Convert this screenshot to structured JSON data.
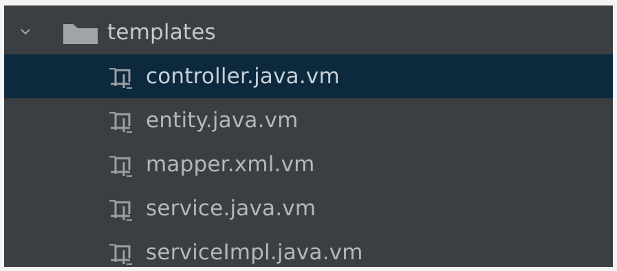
{
  "tree": {
    "folder": {
      "label": "templates",
      "icon": "folder-icon",
      "expanded": true
    },
    "files": [
      {
        "label": "controller.java.vm",
        "icon": "velocity-template-icon",
        "selected": true
      },
      {
        "label": "entity.java.vm",
        "icon": "velocity-template-icon",
        "selected": false
      },
      {
        "label": "mapper.xml.vm",
        "icon": "velocity-template-icon",
        "selected": false
      },
      {
        "label": "service.java.vm",
        "icon": "velocity-template-icon",
        "selected": false
      },
      {
        "label": "serviceImpl.java.vm",
        "icon": "velocity-template-icon",
        "selected": false
      }
    ]
  },
  "colors": {
    "panel_background": "#3c3f41",
    "selection_background": "#0d293e",
    "text": "#b3b8bd",
    "icon": "#9aa0a6"
  }
}
